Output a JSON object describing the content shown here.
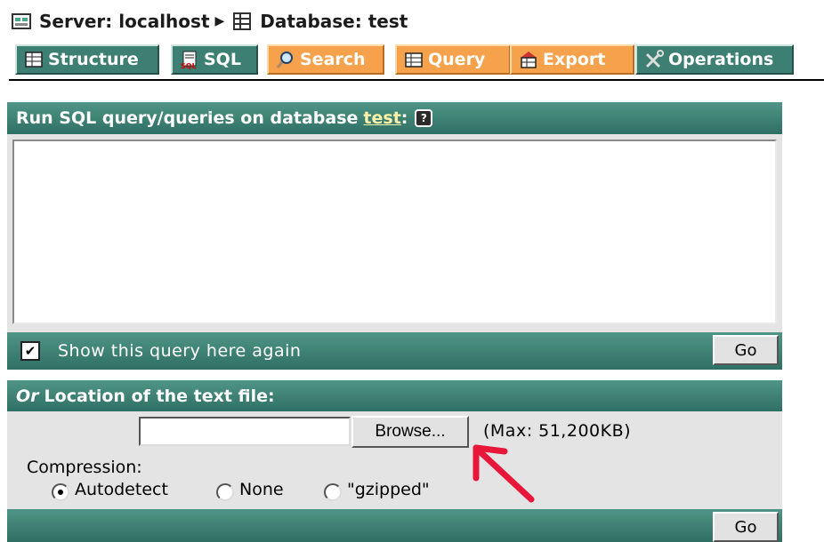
{
  "breadcrumb": {
    "server": "Server: localhost",
    "database": "Database: test"
  },
  "tabs": [
    {
      "label": "Structure",
      "icon": "structure-icon",
      "style": "green"
    },
    {
      "label": "SQL",
      "icon": "sql-icon",
      "style": "green"
    },
    {
      "label": "Search",
      "icon": "search-icon",
      "style": "orange"
    },
    {
      "label": "Query",
      "icon": "query-icon",
      "style": "orange"
    },
    {
      "label": "Export",
      "icon": "export-icon",
      "style": "orange"
    },
    {
      "label": "Operations",
      "icon": "operations-icon",
      "style": "green"
    }
  ],
  "sql_section": {
    "title": "Run SQL query/queries on database",
    "db_link": "test",
    "colon": ":",
    "help": "?",
    "query_text": "",
    "show_again_label": "Show this query here again",
    "show_again_checked": true,
    "go_label": "Go"
  },
  "file_section": {
    "title_prefix": "Or",
    "title": "Location of the text file:",
    "browse_label": "Browse...",
    "max_label": "(Max: 51,200KB)",
    "compression_label": "Compression:",
    "options": [
      {
        "label": "Autodetect",
        "checked": true
      },
      {
        "label": "None",
        "checked": false
      },
      {
        "label": "\"gzipped\"",
        "checked": false
      }
    ],
    "go_label": "Go"
  },
  "colors": {
    "bar_green": "#3d7f72",
    "tab_orange": "#f6a14c",
    "panel_gray": "#e4e4e4",
    "arrow_red": "#e8173a"
  }
}
